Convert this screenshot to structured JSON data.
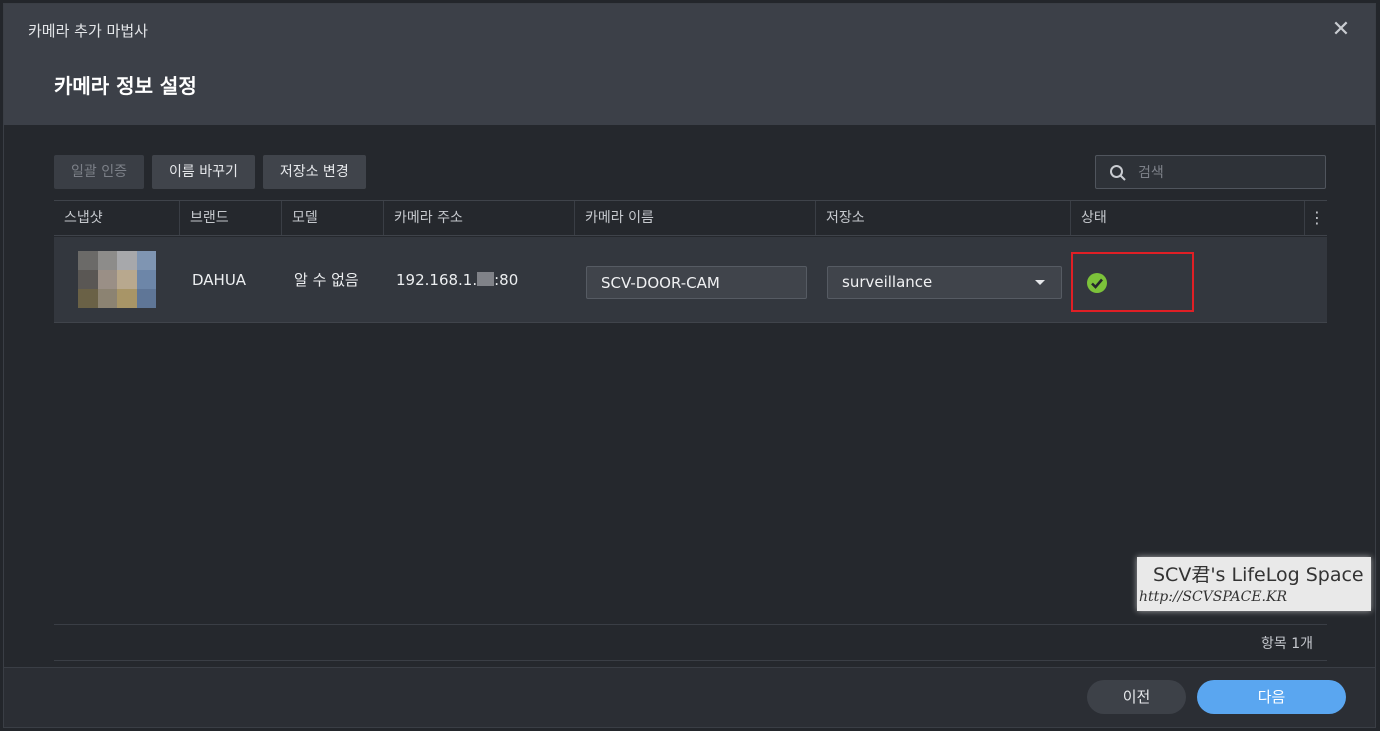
{
  "window": {
    "wizard_title": "카메라 추가 마법사",
    "step_title": "카메라 정보 설정"
  },
  "toolbar": {
    "bulk_auth_label": "일괄 인증",
    "rename_label": "이름 바꾸기",
    "change_storage_label": "저장소 변경"
  },
  "search": {
    "placeholder": "검색"
  },
  "table": {
    "headers": [
      "스냅샷",
      "브랜드",
      "모델",
      "카메라 주소",
      "카메라 이름",
      "저장소",
      "상태"
    ],
    "rows": [
      {
        "brand": "DAHUA",
        "model": "알 수 없음",
        "address_prefix": "192.168.1.",
        "address_suffix": ":80",
        "camera_name": "SCV-DOOR-CAM",
        "storage": "surveillance",
        "status": "ok"
      }
    ]
  },
  "footer": {
    "item_count": "항목 1개",
    "prev_label": "이전",
    "next_label": "다음"
  },
  "watermark": {
    "line1": "SCV君's LifeLog Space",
    "line2": "http://SCVSPACE.KR"
  },
  "colors": {
    "accent": "#5aa6f0",
    "status_ok": "#7cc23a",
    "highlight": "#e01f25"
  }
}
